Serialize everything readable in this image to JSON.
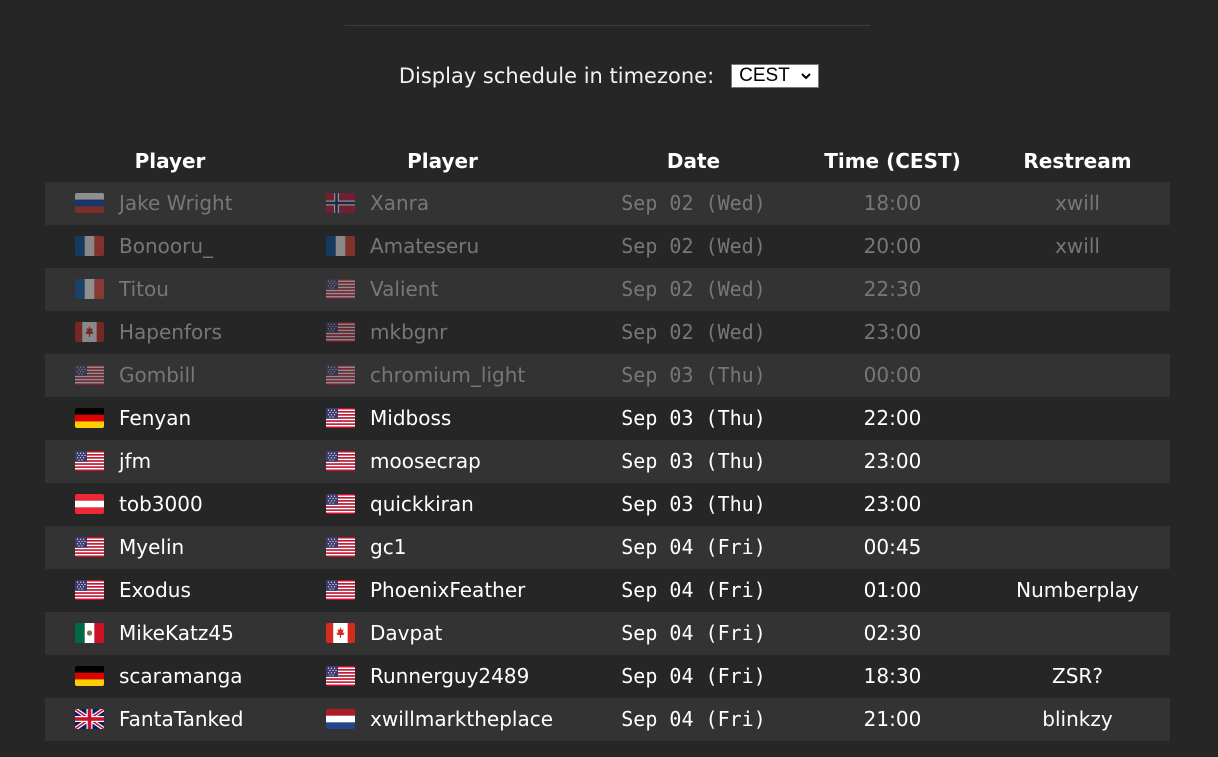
{
  "timezone": {
    "label": "Display schedule in timezone:",
    "selected": "CEST"
  },
  "schedule": {
    "headers": {
      "player1": "Player",
      "player2": "Player",
      "date": "Date",
      "time": "Time (CEST)",
      "restream": "Restream"
    },
    "rows": [
      {
        "p1": "Jake Wright",
        "p1_flag": "russia-flag-icon",
        "p2": "Xanra",
        "p2_flag": "norway-flag-icon",
        "date": "Sep 02 (Wed)",
        "time": "18:00",
        "restream": "xwill",
        "past": true
      },
      {
        "p1": "Bonooru_",
        "p1_flag": "france-flag-icon",
        "p2": "Amateseru",
        "p2_flag": "france-flag-icon",
        "date": "Sep 02 (Wed)",
        "time": "20:00",
        "restream": "xwill",
        "past": true
      },
      {
        "p1": "Titou",
        "p1_flag": "france-flag-icon",
        "p2": "Valient",
        "p2_flag": "usa-flag-icon",
        "date": "Sep 02 (Wed)",
        "time": "22:30",
        "restream": "",
        "past": true
      },
      {
        "p1": "Hapenfors",
        "p1_flag": "canada-flag-icon",
        "p2": "mkbgnr",
        "p2_flag": "usa-flag-icon",
        "date": "Sep 02 (Wed)",
        "time": "23:00",
        "restream": "",
        "past": true
      },
      {
        "p1": "Gombill",
        "p1_flag": "usa-flag-icon",
        "p2": "chromium_light",
        "p2_flag": "usa-flag-icon",
        "date": "Sep 03 (Thu)",
        "time": "00:00",
        "restream": "",
        "past": true
      },
      {
        "p1": "Fenyan",
        "p1_flag": "germany-flag-icon",
        "p2": "Midboss",
        "p2_flag": "usa-flag-icon",
        "date": "Sep 03 (Thu)",
        "time": "22:00",
        "restream": "",
        "past": false
      },
      {
        "p1": "jfm",
        "p1_flag": "usa-flag-icon",
        "p2": "moosecrap",
        "p2_flag": "usa-flag-icon",
        "date": "Sep 03 (Thu)",
        "time": "23:00",
        "restream": "",
        "past": false
      },
      {
        "p1": "tob3000",
        "p1_flag": "austria-flag-icon",
        "p2": "quickkiran",
        "p2_flag": "usa-flag-icon",
        "date": "Sep 03 (Thu)",
        "time": "23:00",
        "restream": "",
        "past": false
      },
      {
        "p1": "Myelin",
        "p1_flag": "usa-flag-icon",
        "p2": "gc1",
        "p2_flag": "usa-flag-icon",
        "date": "Sep 04 (Fri)",
        "time": "00:45",
        "restream": "",
        "past": false
      },
      {
        "p1": "Exodus",
        "p1_flag": "usa-flag-icon",
        "p2": "PhoenixFeather",
        "p2_flag": "usa-flag-icon",
        "date": "Sep 04 (Fri)",
        "time": "01:00",
        "restream": "Numberplay",
        "past": false
      },
      {
        "p1": "MikeKatz45",
        "p1_flag": "mexico-flag-icon",
        "p2": "Davpat",
        "p2_flag": "canada-flag-icon",
        "date": "Sep 04 (Fri)",
        "time": "02:30",
        "restream": "",
        "past": false
      },
      {
        "p1": "scaramanga",
        "p1_flag": "germany-flag-icon",
        "p2": "Runnerguy2489",
        "p2_flag": "usa-flag-icon",
        "date": "Sep 04 (Fri)",
        "time": "18:30",
        "restream": "ZSR?",
        "past": false
      },
      {
        "p1": "FantaTanked",
        "p1_flag": "uk-flag-icon",
        "p2": "xwillmarktheplace",
        "p2_flag": "netherlands-flag-icon",
        "date": "Sep 04 (Fri)",
        "time": "21:00",
        "restream": "blinkzy",
        "past": false
      }
    ]
  }
}
